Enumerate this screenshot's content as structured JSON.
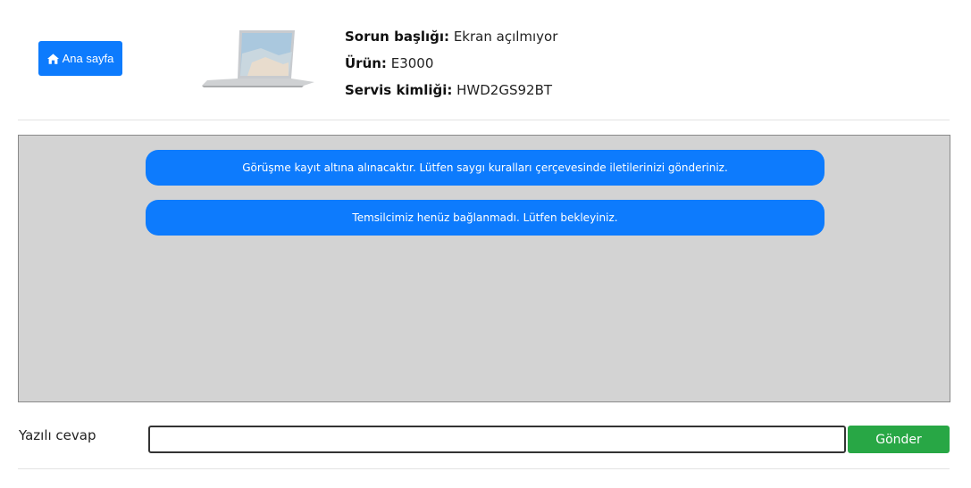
{
  "header": {
    "home_button_label": "Ana sayfa",
    "home_icon": "home-icon",
    "product_image": "laptop-image",
    "fields": [
      {
        "label": "Sorun başlığı:",
        "value": "Ekran açılmıyor"
      },
      {
        "label": "Ürün:",
        "value": "E3000"
      },
      {
        "label": "Servis kimliği:",
        "value": "HWD2GS92BT"
      }
    ]
  },
  "chat": {
    "messages": [
      {
        "text": "Görüşme kayıt altına alınacaktır. Lütfen saygı kuralları çerçevesinde iletilerinizi gönderiniz."
      },
      {
        "text": "Temsilcimiz henüz bağlanmadı. Lütfen bekleyiniz."
      }
    ]
  },
  "reply": {
    "label": "Yazılı cevap",
    "value": "",
    "send_label": "Gönder"
  },
  "colors": {
    "primary": "#0d7bfd",
    "success": "#28a745",
    "chat_bg": "#d3d3d3"
  }
}
